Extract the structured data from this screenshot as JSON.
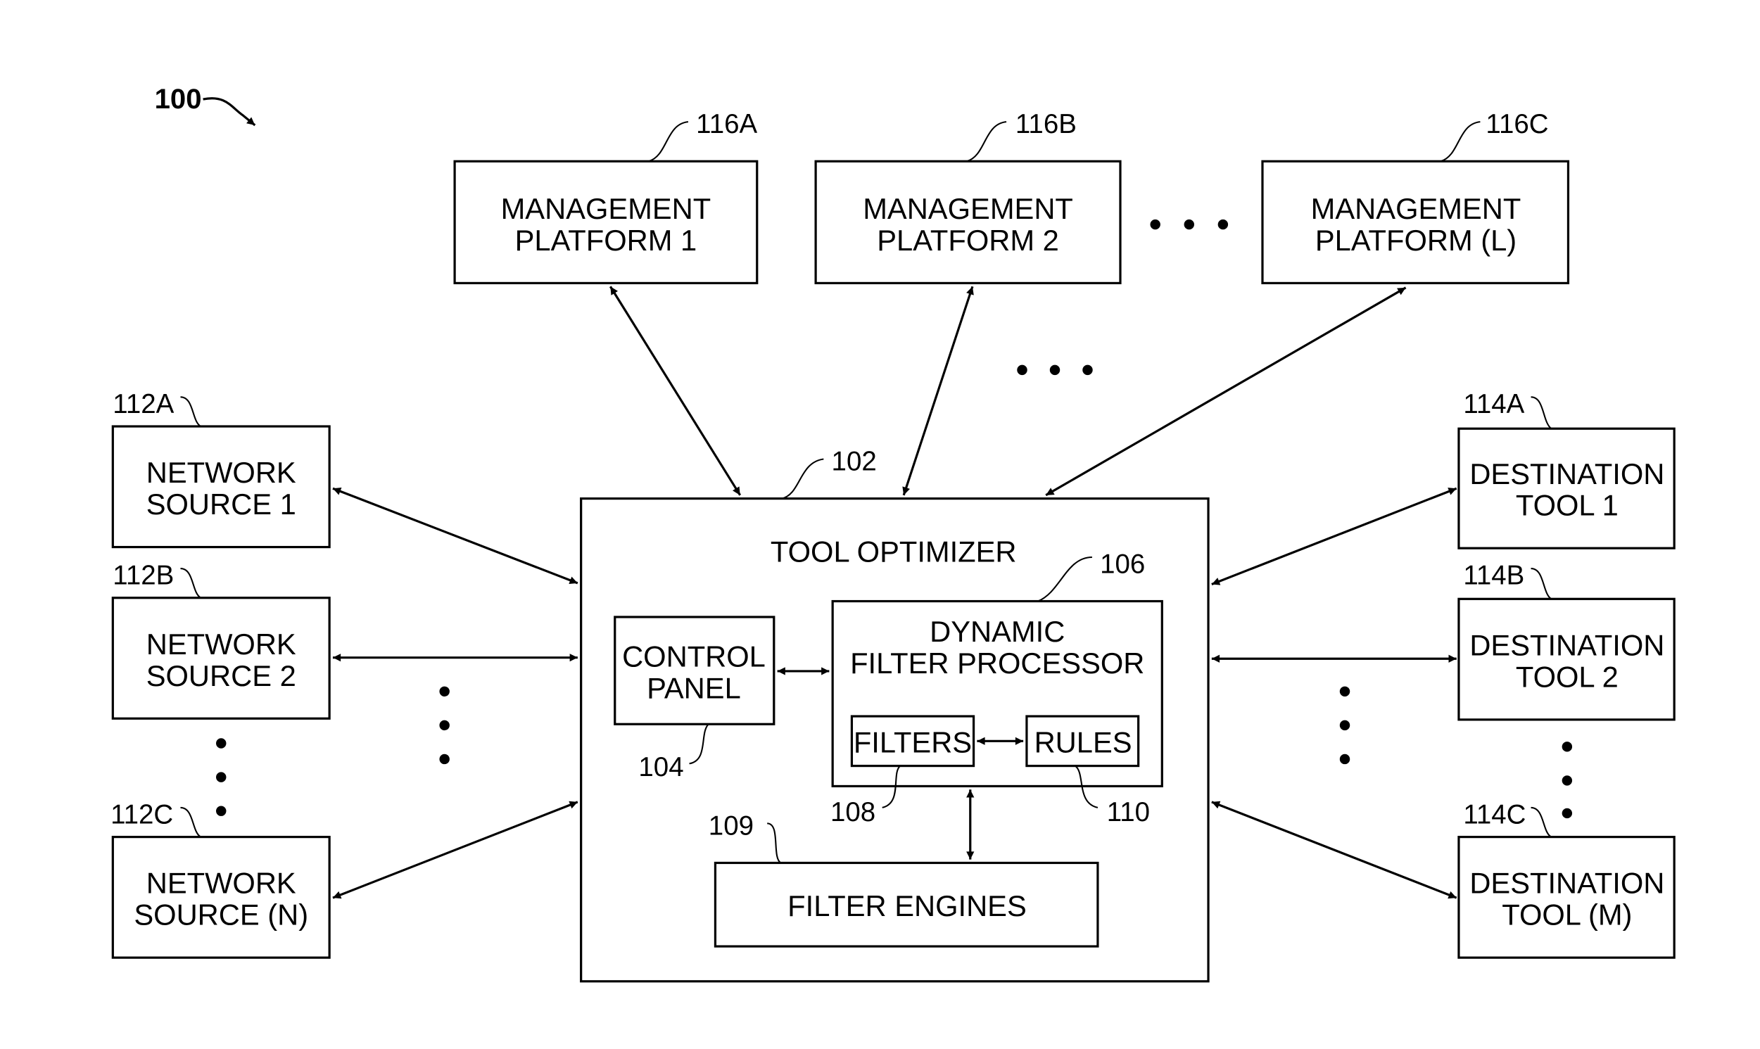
{
  "figure": {
    "reference": "100",
    "tool_optimizer": {
      "ref": "102",
      "title": "TOOL OPTIMIZER"
    },
    "control_panel": {
      "ref": "104",
      "lines": [
        "CONTROL",
        "PANEL"
      ]
    },
    "dynamic_filter_processor": {
      "ref": "106",
      "lines": [
        "DYNAMIC",
        "FILTER PROCESSOR"
      ]
    },
    "filters": {
      "ref": "108",
      "label": "FILTERS"
    },
    "filter_engines": {
      "ref": "109",
      "label": "FILTER ENGINES"
    },
    "rules": {
      "ref": "110",
      "label": "RULES"
    },
    "network_sources": [
      {
        "ref": "112A",
        "lines": [
          "NETWORK",
          "SOURCE 1"
        ]
      },
      {
        "ref": "112B",
        "lines": [
          "NETWORK",
          "SOURCE 2"
        ]
      },
      {
        "ref": "112C",
        "lines": [
          "NETWORK",
          "SOURCE (N)"
        ]
      }
    ],
    "destination_tools": [
      {
        "ref": "114A",
        "lines": [
          "DESTINATION",
          "TOOL 1"
        ]
      },
      {
        "ref": "114B",
        "lines": [
          "DESTINATION",
          "TOOL 2"
        ]
      },
      {
        "ref": "114C",
        "lines": [
          "DESTINATION",
          "TOOL (M)"
        ]
      }
    ],
    "management_platforms": [
      {
        "ref": "116A",
        "lines": [
          "MANAGEMENT",
          "PLATFORM 1"
        ]
      },
      {
        "ref": "116B",
        "lines": [
          "MANAGEMENT",
          "PLATFORM 2"
        ]
      },
      {
        "ref": "116C",
        "lines": [
          "MANAGEMENT",
          "PLATFORM (L)"
        ]
      }
    ],
    "connections": [
      {
        "from": "NETWORK SOURCE 1",
        "to": "TOOL OPTIMIZER",
        "direction": "bidirectional"
      },
      {
        "from": "NETWORK SOURCE 2",
        "to": "TOOL OPTIMIZER",
        "direction": "bidirectional"
      },
      {
        "from": "NETWORK SOURCE (N)",
        "to": "TOOL OPTIMIZER",
        "direction": "bidirectional"
      },
      {
        "from": "TOOL OPTIMIZER",
        "to": "DESTINATION TOOL 1",
        "direction": "bidirectional"
      },
      {
        "from": "TOOL OPTIMIZER",
        "to": "DESTINATION TOOL 2",
        "direction": "bidirectional"
      },
      {
        "from": "TOOL OPTIMIZER",
        "to": "DESTINATION TOOL (M)",
        "direction": "bidirectional"
      },
      {
        "from": "MANAGEMENT PLATFORM 1",
        "to": "TOOL OPTIMIZER",
        "direction": "bidirectional"
      },
      {
        "from": "MANAGEMENT PLATFORM 2",
        "to": "TOOL OPTIMIZER",
        "direction": "bidirectional"
      },
      {
        "from": "MANAGEMENT PLATFORM (L)",
        "to": "TOOL OPTIMIZER",
        "direction": "bidirectional"
      },
      {
        "from": "CONTROL PANEL",
        "to": "DYNAMIC FILTER PROCESSOR",
        "direction": "bidirectional"
      },
      {
        "from": "FILTERS",
        "to": "RULES",
        "direction": "bidirectional"
      },
      {
        "from": "DYNAMIC FILTER PROCESSOR",
        "to": "FILTER ENGINES",
        "direction": "bidirectional"
      }
    ]
  }
}
